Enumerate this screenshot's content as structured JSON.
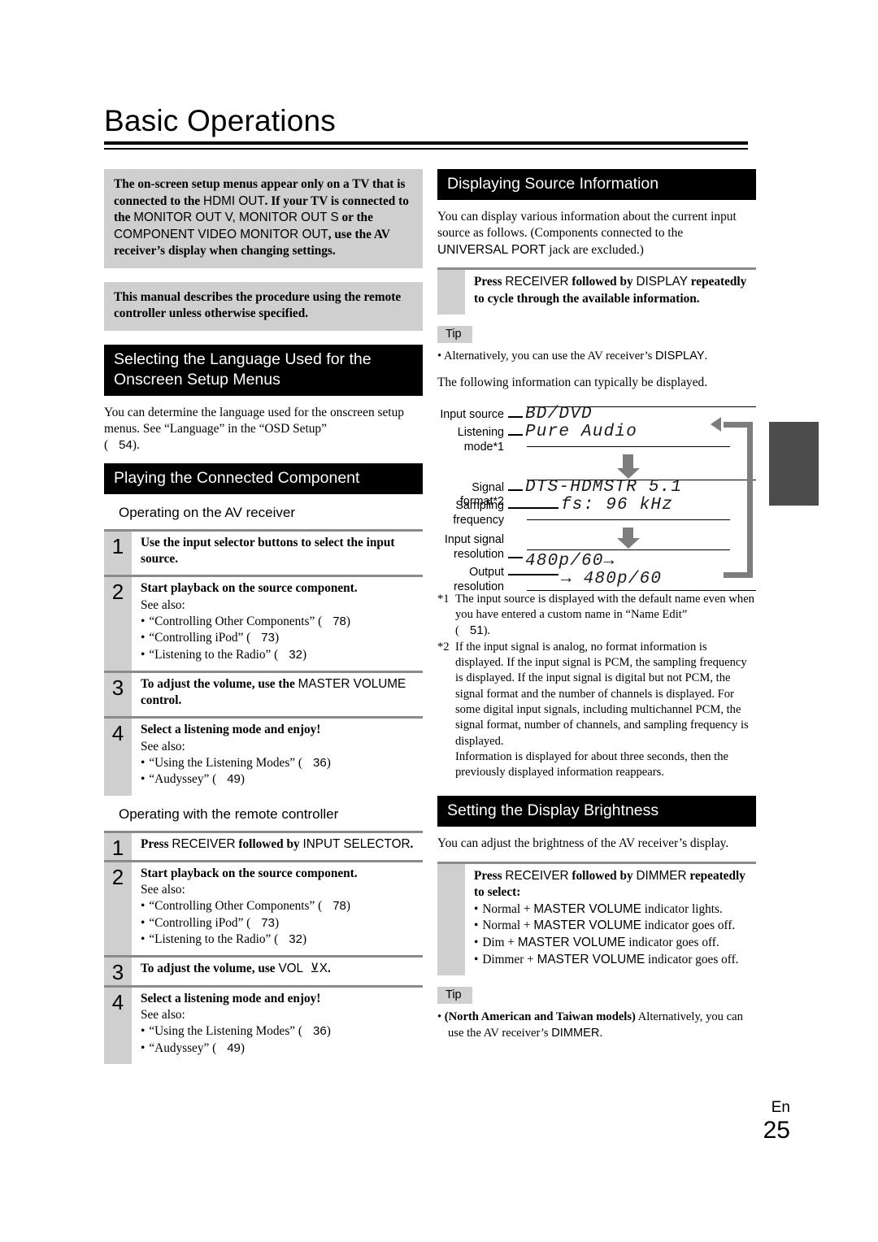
{
  "page": {
    "title": "Basic Operations",
    "footer_lang": "En",
    "footer_number": "25"
  },
  "left_column": {
    "note_1": "The on-screen setup menus appear only on a TV that is connected to the HDMI OUT. If your TV is connected to the MONITOR OUT V, MONITOR OUT S or the COMPONENT VIDEO MONITOR OUT, use the AV receiver's display when changing settings.",
    "note_2": "This manual describes the procedure using the remote controller unless otherwise specified.",
    "section_language": {
      "heading": "Selecting the Language Used for the Onscreen Setup Menus",
      "body": "You can determine the language used for the onscreen setup menus. See “Language” in the “OSD Setup”",
      "page_ref": "54"
    },
    "section_playing": {
      "heading": "Playing the Connected Component",
      "sub_receiver": "Operating on the AV receiver",
      "sub_remote": "Operating with the remote controller",
      "receiver_steps": [
        {
          "number": "1",
          "title": "Use the input selector buttons to select the input source.",
          "see_also": "",
          "items": []
        },
        {
          "number": "2",
          "title": "Start playback on the source component.",
          "see_also": "See also:",
          "items": [
            {
              "label": "“Controlling Other Components” (",
              "page": "78",
              "close": ")"
            },
            {
              "label": "“Controlling iPod” (",
              "page": "73",
              "close": ")"
            },
            {
              "label": "“Listening to the Radio” (",
              "page": "32",
              "close": ")"
            }
          ]
        },
        {
          "number": "3",
          "title": "To adjust the volume, use the MASTER VOLUME control.",
          "see_also": "",
          "items": []
        },
        {
          "number": "4",
          "title": "Select a listening mode and enjoy!",
          "see_also": "See also:",
          "items": [
            {
              "label": "“Using the Listening Modes” (",
              "page": "36",
              "close": ")"
            },
            {
              "label": "“Audyssey” (",
              "page": "49",
              "close": ")"
            }
          ]
        }
      ],
      "remote_steps": [
        {
          "number": "1",
          "title": "Press RECEIVER followed by INPUT SELECTOR.",
          "see_also": "",
          "items": []
        },
        {
          "number": "2",
          "title": "Start playback on the source component.",
          "see_also": "See also:",
          "items": [
            {
              "label": "“Controlling Other Components” (",
              "page": "78",
              "close": ")"
            },
            {
              "label": "“Controlling iPod” (",
              "page": "73",
              "close": ")"
            },
            {
              "label": "“Listening to the Radio” (",
              "page": "32",
              "close": ")"
            }
          ]
        },
        {
          "number": "3",
          "title": "To adjust the volume, use VOL ⊻X.",
          "see_also": "",
          "items": []
        },
        {
          "number": "4",
          "title": "Select a listening mode and enjoy!",
          "see_also": "See also:",
          "items": [
            {
              "label": "“Using the Listening Modes” (",
              "page": "36",
              "close": ")"
            },
            {
              "label": "“Audyssey” (",
              "page": "49",
              "close": ")"
            }
          ]
        }
      ]
    }
  },
  "right_column": {
    "section_source_info": {
      "heading": "Displaying Source Information",
      "body": "You can display various information about the current input source as follows. (Components connected to the UNIVERSAL PORT jack are excluded.)",
      "press_instruction": "Press RECEIVER followed by DISPLAY repeatedly to cycle through the available information.",
      "tip_label": "Tip",
      "tip_text": "Alternatively, you can use the AV receiver's DISPLAY.",
      "intro": "The following information can typically be displayed."
    },
    "diagram": {
      "labels": {
        "input_source": "Input source",
        "listening_mode_l1": "Listening",
        "listening_mode_l2": "mode*1",
        "signal_format": "Signal format*2",
        "sampling_l1": "Sampling",
        "sampling_l2": "frequency",
        "input_res_l1": "Input signal",
        "input_res_l2": "resolution",
        "output_res_l1": "Output",
        "output_res_l2": "resolution"
      },
      "screens": {
        "input_source": "BD/DVD",
        "listening_mode": "Pure Audio",
        "signal_format": "DTS-HDMSTR 5.1",
        "sampling_frequency": "fs: 96 kHz",
        "input_resolution": "480p/60→",
        "output_resolution": "→ 480p/60"
      }
    },
    "footnotes": [
      {
        "mark": "*1",
        "text": "The input source is displayed with the default name even when you have entered a custom name in “Name Edit”",
        "page_ref": "51"
      },
      {
        "mark": "*2",
        "text": "If the input signal is analog, no format information is displayed. If the input signal is PCM, the sampling frequency is displayed. If the input signal is digital but not PCM, the signal format and the number of channels is displayed. For some digital input signals, including multichannel PCM, the signal format, number of channels, and sampling frequency is displayed.",
        "page_ref": ""
      }
    ],
    "footnote_extra": "Information is displayed for about three seconds, then the previously displayed information reappears.",
    "section_brightness": {
      "heading": "Setting the Display Brightness",
      "body": "You can adjust the brightness of the AV receiver's display.",
      "press_instruction": "Press RECEIVER followed by DIMMER repeatedly to select:",
      "options": [
        "Normal + MASTER VOLUME indicator lights.",
        "Normal + MASTER VOLUME indicator goes off.",
        "Dim + MASTER VOLUME indicator goes off.",
        "Dimmer + MASTER VOLUME indicator goes off."
      ],
      "tip_label": "Tip",
      "tip_bold": "(North American and Taiwan models)",
      "tip_text": "Alternatively, you can use the AV receiver's DIMMER."
    }
  },
  "colors": {
    "heading_bg": "#000000",
    "note_bg": "#cfcfcf",
    "rule": "#8a8a8a",
    "edge_tab": "#4c4c4c",
    "diagram_arrow": "#7d7d7d"
  }
}
